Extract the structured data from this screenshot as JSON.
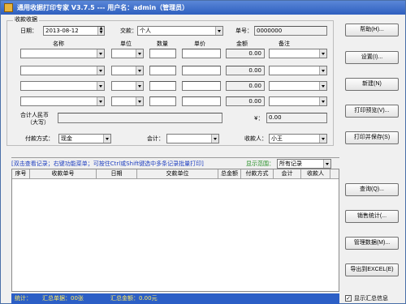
{
  "window": {
    "title": "通用收据打印专家 V3.7.5 --- 用户名：admin（管理员）"
  },
  "receipt": {
    "group_title": "收款收据",
    "date_label": "日期：",
    "date_value": "2013-08-12",
    "payer_label": "交款：",
    "payer_value": "个人",
    "number_label": "单号：",
    "number_value": "0000000",
    "columns": [
      "名称",
      "单位",
      "数量",
      "单价",
      "金额",
      "备注"
    ],
    "rows": [
      {
        "name": "",
        "unit": "",
        "qty": "",
        "price": "",
        "amount": "0.00",
        "note": ""
      },
      {
        "name": "",
        "unit": "",
        "qty": "",
        "price": "",
        "amount": "0.00",
        "note": ""
      },
      {
        "name": "",
        "unit": "",
        "qty": "",
        "price": "",
        "amount": "0.00",
        "note": ""
      },
      {
        "name": "",
        "unit": "",
        "qty": "",
        "price": "",
        "amount": "0.00",
        "note": ""
      }
    ],
    "total_rmb_label_1": "合计人民币",
    "total_rmb_label_2": "（大写）",
    "yen_label": "¥：",
    "yen_value": "0.00",
    "pay_method_label": "付款方式：",
    "pay_method_value": "现金",
    "accountant_label": "会计：",
    "accountant_value": "",
    "payee_label": "收款人：",
    "payee_value": "小王"
  },
  "buttons": {
    "help": "帮助(H)...",
    "settings": "设置(I)...",
    "new": "新建(N)",
    "preview": "打印预览(V)...",
    "print_save": "打印并保存(S)",
    "query": "查询(Q)...",
    "stats": "销售统计(...",
    "manage": "管理数据(M)...",
    "export": "导出到EXCEL(E)"
  },
  "records": {
    "hint": "[双击查看记录；右键功能菜单；可按住Ctrl或Shift键选中多条记录批量打印]",
    "range_label": "显示范围：",
    "range_value": "所有记录",
    "columns": [
      "序号",
      "收款单号",
      "日期",
      "交款单位",
      "总金额",
      "付款方式",
      "会计",
      "收款人"
    ]
  },
  "status": {
    "label": "统计：",
    "count_text": "汇总单据：00张",
    "amount_text": "汇总金额：0.00元"
  },
  "summary_checkbox": {
    "label": "显示汇总信息",
    "checked": true
  }
}
